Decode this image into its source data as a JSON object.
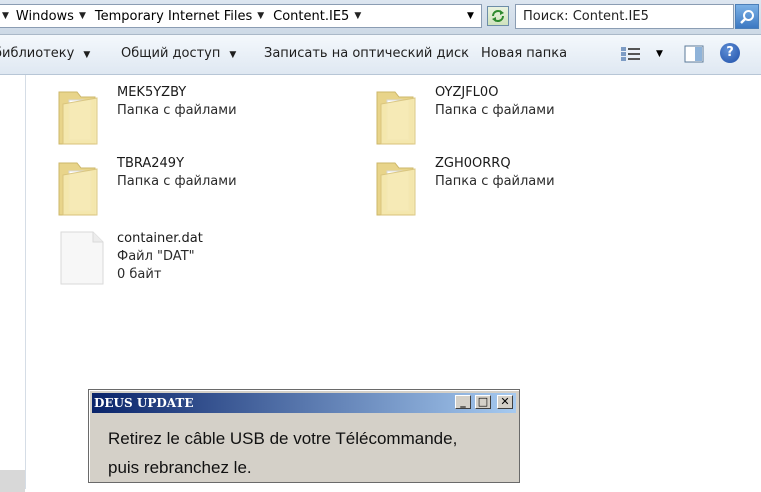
{
  "address_bar": {
    "breadcrumbs": [
      "Windows",
      "Temporary Internet Files",
      "Content.IE5"
    ],
    "search_text": "Поиск: Content.IE5"
  },
  "toolbar": {
    "library_label": "библиотеку",
    "share_label": "Общий доступ",
    "burn_label": "Записать на оптический диск",
    "new_folder_label": "Новая папка"
  },
  "items": [
    {
      "name": "MEK5YZBY",
      "type": "Папка с файлами",
      "kind": "folder"
    },
    {
      "name": "OYZJFL0O",
      "type": "Папка с файлами",
      "kind": "folder"
    },
    {
      "name": "TBRA249Y",
      "type": "Папка с файлами",
      "kind": "folder"
    },
    {
      "name": "ZGH0ORRQ",
      "type": "Папка с файлами",
      "kind": "folder"
    },
    {
      "name": "container.dat",
      "type": "Файл \"DAT\"",
      "size": "0 байт",
      "kind": "file"
    }
  ],
  "popup": {
    "title": "DEUS UPDATE",
    "line1": "Retirez le câble USB de votre Télécommande,",
    "line2": "puis rebranchez le."
  },
  "colors": {
    "title_gradient_start": "#0a246a",
    "title_gradient_end": "#a6caf0",
    "dialog_bg": "#d4d0c8"
  }
}
